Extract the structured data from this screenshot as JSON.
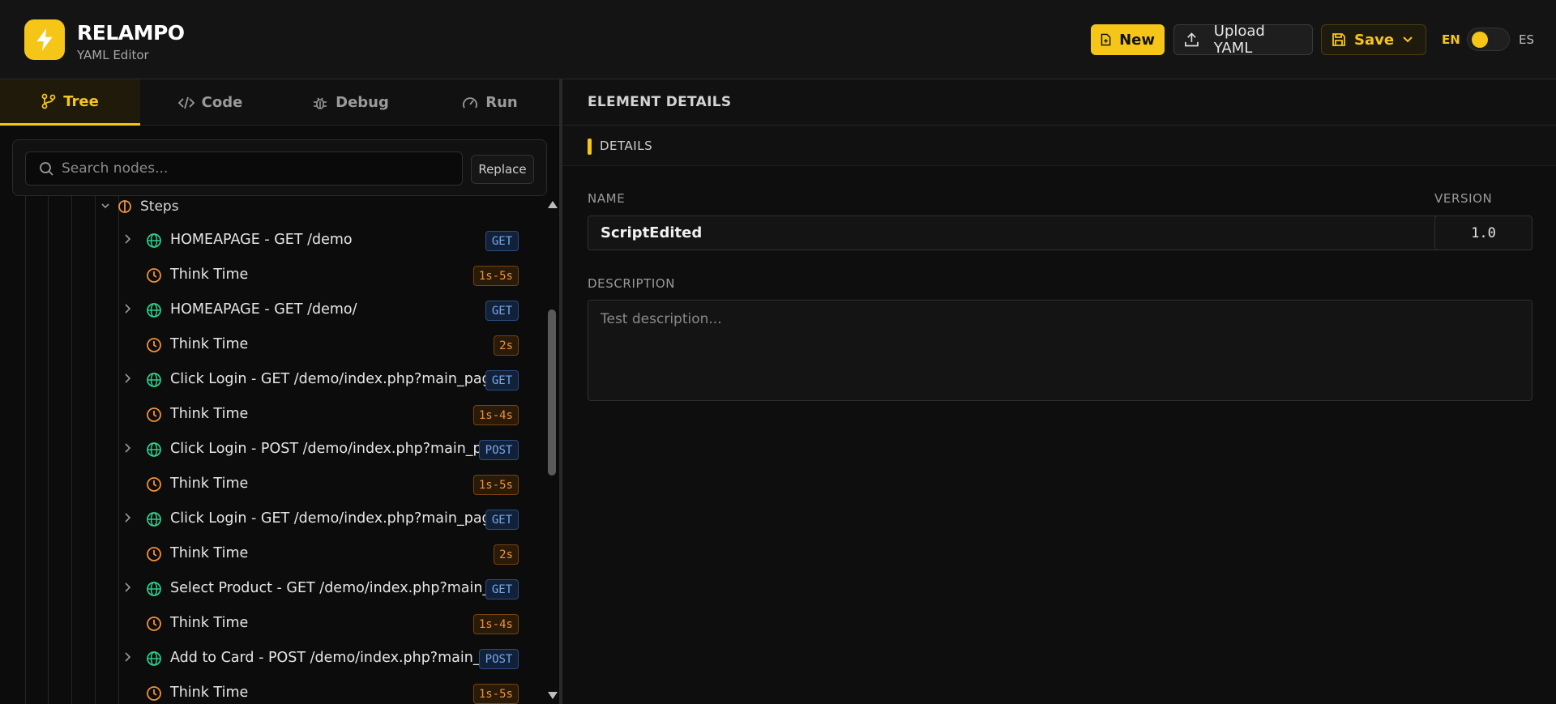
{
  "app": {
    "brand": "RELAMPO",
    "subtitle": "YAML Editor"
  },
  "toolbar": {
    "new_label": "New",
    "upload_label": "Upload YAML",
    "save_label": "Save"
  },
  "language": {
    "left": "EN",
    "right": "ES",
    "active": "EN"
  },
  "tabs": [
    {
      "label": "Tree",
      "icon": "git-branch-icon",
      "active": true
    },
    {
      "label": "Code",
      "icon": "code-icon",
      "active": false
    },
    {
      "label": "Debug",
      "icon": "bug-icon",
      "active": false
    },
    {
      "label": "Run",
      "icon": "gauge-icon",
      "active": false
    }
  ],
  "search": {
    "placeholder": "Search nodes...",
    "replace_label": "Replace"
  },
  "tree": {
    "steps_label": "Steps",
    "rows": [
      {
        "type": "request",
        "label": "HOMEAPAGE - GET /demo",
        "badge": "GET"
      },
      {
        "type": "think",
        "label": "Think Time",
        "badge": "1s-5s"
      },
      {
        "type": "request",
        "label": "HOMEAPAGE - GET /demo/",
        "badge": "GET"
      },
      {
        "type": "think",
        "label": "Think Time",
        "badge": "2s"
      },
      {
        "type": "request",
        "label": "Click Login - GET /demo/index.php?main_page...",
        "badge": "GET"
      },
      {
        "type": "think",
        "label": "Think Time",
        "badge": "1s-4s"
      },
      {
        "type": "request",
        "label": "Click Login - POST /demo/index.php?main_pa...",
        "badge": "POST"
      },
      {
        "type": "think",
        "label": "Think Time",
        "badge": "1s-5s"
      },
      {
        "type": "request",
        "label": "Click Login - GET /demo/index.php?main_page...",
        "badge": "GET"
      },
      {
        "type": "think",
        "label": "Think Time",
        "badge": "2s"
      },
      {
        "type": "request",
        "label": "Select Product - GET /demo/index.php?main_p...",
        "badge": "GET"
      },
      {
        "type": "think",
        "label": "Think Time",
        "badge": "1s-4s"
      },
      {
        "type": "request",
        "label": "Add to Card - POST /demo/index.php?main_p...",
        "badge": "POST"
      },
      {
        "type": "think",
        "label": "Think Time",
        "badge": "1s-5s"
      }
    ]
  },
  "details": {
    "panel_title": "ELEMENT DETAILS",
    "section_title": "DETAILS",
    "name_label": "NAME",
    "name_value": "ScriptEdited",
    "version_label": "VERSION",
    "version_value": "1.0",
    "description_label": "DESCRIPTION",
    "description_placeholder": "Test description..."
  },
  "colors": {
    "accent": "#f5c518",
    "request_icon": "#2ecf8a",
    "think_icon": "#f0923a",
    "method_badge": "#78a8e8"
  }
}
